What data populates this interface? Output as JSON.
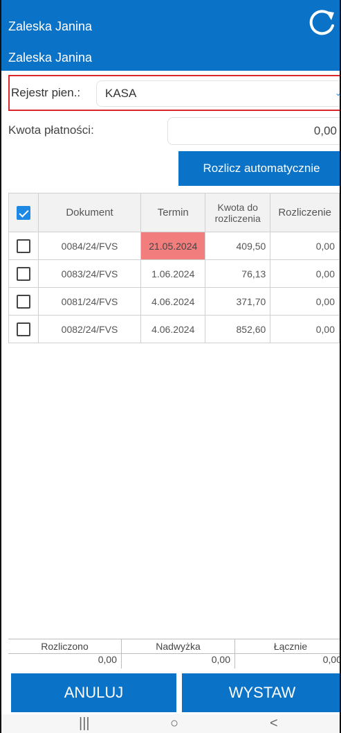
{
  "header": {
    "title": "Zaleska Janina",
    "subtitle": "Zaleska Janina",
    "refresh_icon": "refresh-icon"
  },
  "register": {
    "label": "Rejestr pien.:",
    "value": "KASA"
  },
  "payment": {
    "label": "Kwota płatności:",
    "value": "0,00"
  },
  "auto_button": "Rozlicz automatycznie",
  "table": {
    "headers": [
      "Dokument",
      "Termin",
      "Kwota do rozliczenia",
      "Rozliczenie"
    ],
    "header_checked": true,
    "rows": [
      {
        "doc": "0084/24/FVS",
        "date": "21.05.2024",
        "amount": "409,50",
        "settle": "0,00",
        "overdue": true
      },
      {
        "doc": "0083/24/FVS",
        "date": "1.06.2024",
        "amount": "76,13",
        "settle": "0,00",
        "overdue": false
      },
      {
        "doc": "0081/24/FVS",
        "date": "4.06.2024",
        "amount": "371,70",
        "settle": "0,00",
        "overdue": false
      },
      {
        "doc": "0082/24/FVS",
        "date": "4.06.2024",
        "amount": "852,60",
        "settle": "0,00",
        "overdue": false
      }
    ]
  },
  "summary": {
    "settled_label": "Rozliczono",
    "settled_value": "0,00",
    "surplus_label": "Nadwyżka",
    "surplus_value": "0,00",
    "total_label": "Łącznie",
    "total_value": "0,00"
  },
  "buttons": {
    "cancel": "ANULUJ",
    "issue": "WYSTAW"
  },
  "navbar": {
    "recent": "|||",
    "home": "○",
    "back": "<"
  },
  "colors": {
    "primary": "#0a73c7",
    "overdue": "#f27d7d",
    "highlight_border": "#d8262b"
  }
}
